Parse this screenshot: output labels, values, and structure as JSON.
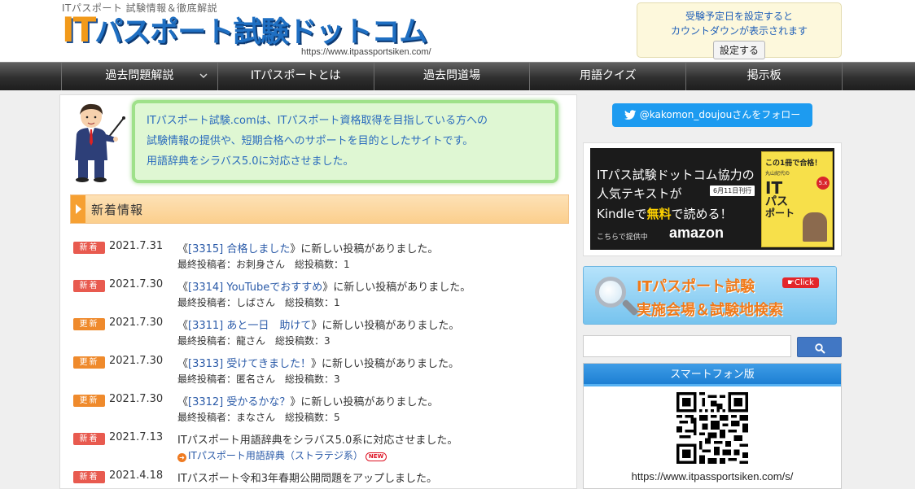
{
  "header": {
    "tagline": "ITパスポート 試験情報＆徹底解説",
    "logo_it": "IT",
    "logo_rest": "パスポート試験ドットコム",
    "logo_url": "https://www.itpassportsiken.com/"
  },
  "countdown": {
    "message_line1": "受験予定日を設定すると",
    "message_line2": "カウントダウンが表示されます",
    "button_label": "設定する"
  },
  "nav": {
    "items": [
      "過去問題解説",
      "ITパスポートとは",
      "過去問道場",
      "用語クイズ",
      "掲示板"
    ]
  },
  "intro": {
    "line1": "ITパスポート試験.comは、ITパスポート資格取得を目指している方への",
    "line2": "試験情報の提供や、短期合格へのサポートを目的としたサイトです。",
    "line3": "用語辞典をシラバス5.0に対応させました。"
  },
  "news": {
    "title": "新着情報",
    "items": [
      {
        "badge": "新着",
        "type": "new",
        "date": "2021.7.31",
        "pre": "《",
        "link": "[3315] 合格しました",
        "post": "》に新しい投稿がありました。",
        "sub": "最終投稿者：お刺身さん　総投稿数：1"
      },
      {
        "badge": "新着",
        "type": "new",
        "date": "2021.7.30",
        "pre": "《",
        "link": "[3314] YouTubeでおすすめ",
        "post": "》に新しい投稿がありました。",
        "sub": "最終投稿者：しばさん　総投稿数：1"
      },
      {
        "badge": "更新",
        "type": "upd",
        "date": "2021.7.30",
        "pre": "《",
        "link": "[3311] あと一日　助けて",
        "post": "》に新しい投稿がありました。",
        "sub": "最終投稿者：龍さん　総投稿数：3"
      },
      {
        "badge": "更新",
        "type": "upd",
        "date": "2021.7.30",
        "pre": "《",
        "link": "[3313] 受けてきました！",
        "post": "》に新しい投稿がありました。",
        "sub": "最終投稿者：匿名さん　総投稿数：3"
      },
      {
        "badge": "更新",
        "type": "upd",
        "date": "2021.7.30",
        "pre": "《",
        "link": "[3312] 受かるかな？",
        "post": "》に新しい投稿がありました。",
        "sub": "最終投稿者：まなさん　総投稿数：5"
      },
      {
        "badge": "新着",
        "type": "new",
        "date": "2021.7.13",
        "pre": "",
        "link": "",
        "post": "ITパスポート用語辞典をシラバス5.0系に対応させました。",
        "sub_link": "ITパスポート用語辞典（ストラテジ系）",
        "new_tag": "NEW"
      },
      {
        "badge": "新着",
        "type": "new",
        "date": "2021.4.18",
        "pre": "",
        "link": "",
        "post": "ITパスポート令和3年春期公開問題をアップしました。"
      }
    ]
  },
  "twitter": {
    "label": "@kakomon_doujouさんをフォロー"
  },
  "book_ad": {
    "line1": "ITパス試験ドットコム協力の",
    "line2": "人気テキストが",
    "date_badge": "6月11日刊行",
    "line3_pre": "Kindleで",
    "line3_free": "無料",
    "line3_post": "で読める！",
    "amazon_pre": "こちらで提供中",
    "amazon": "amazon",
    "cover_catch": "この1冊で合格！",
    "cover_author": "丸山紀代の",
    "cover_title_1": "IT",
    "cover_title_2": "パス",
    "cover_title_3": "ポート",
    "cover_badge": "5.x"
  },
  "search_banner": {
    "line1": "ITパスポート試験",
    "line2": "実施会場＆試験地検索",
    "click": "☛Click"
  },
  "search": {
    "placeholder": ""
  },
  "smartphone": {
    "title": "スマートフォン版",
    "url": "https://www.itpassportsiken.com/s/"
  },
  "colors": {
    "nav_bg": "#2f2f2f",
    "link_blue": "#2a5aa8",
    "badge_new": "#e85a4f",
    "badge_update": "#ef8a2c",
    "twitter": "#1d9bf0",
    "intro_green": "#dff7d3",
    "accent_orange": "#f07a1a"
  },
  "icons": {
    "twitter": "twitter-bird-icon",
    "search": "search-icon",
    "chevron": "chevron-down-icon",
    "magnifier": "magnifier-icon",
    "teacher": "teacher-illustration-icon",
    "qr": "qr-code-icon"
  }
}
